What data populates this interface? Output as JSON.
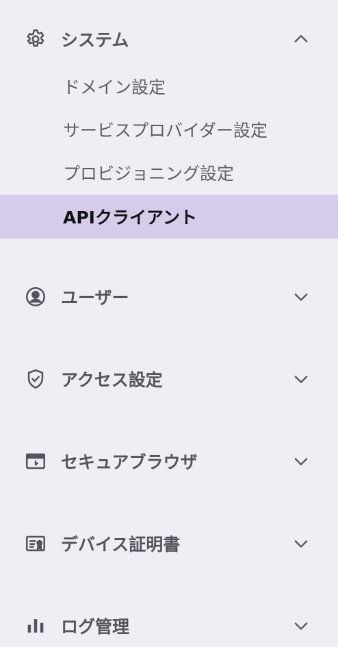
{
  "sections": [
    {
      "label": "システム",
      "icon": "gear-icon",
      "expanded": true,
      "items": [
        {
          "label": "ドメイン設定"
        },
        {
          "label": "サービスプロバイダー設定"
        },
        {
          "label": "プロビジョニング設定"
        },
        {
          "label": "APIクライアント",
          "active": true
        }
      ]
    },
    {
      "label": "ユーザー",
      "icon": "user-circle-icon",
      "expanded": false
    },
    {
      "label": "アクセス設定",
      "icon": "shield-check-icon",
      "expanded": false
    },
    {
      "label": "セキュアブラウザ",
      "icon": "browser-window-icon",
      "expanded": false
    },
    {
      "label": "デバイス証明書",
      "icon": "certificate-icon",
      "expanded": false
    },
    {
      "label": "ログ管理",
      "icon": "bar-chart-icon",
      "expanded": false
    }
  ],
  "colors": {
    "background": "#efeef4",
    "active_background": "#d6cbea",
    "active_text": "#111111",
    "text": "#56535d"
  }
}
